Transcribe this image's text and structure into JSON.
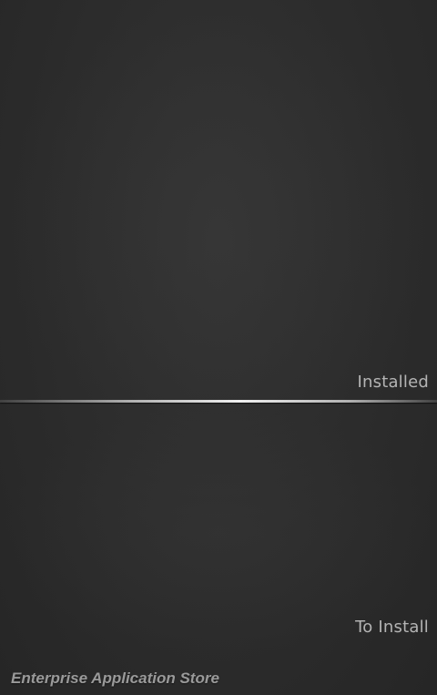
{
  "sections": {
    "installed_label": "Installed",
    "to_install_label": "To Install"
  },
  "footer": {
    "app_title": "Enterprise Application Store"
  }
}
